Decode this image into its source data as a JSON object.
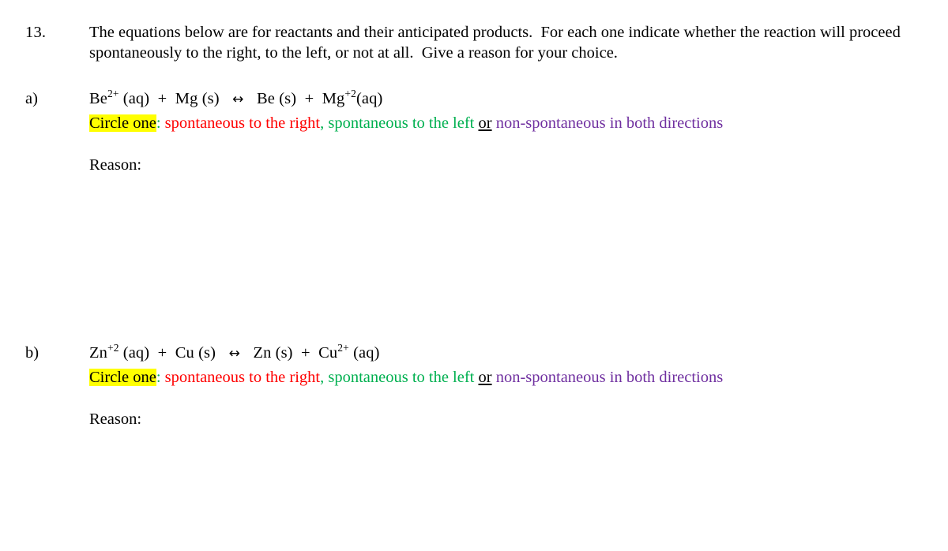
{
  "document": {
    "question_number": "13.",
    "prompt": "The equations below are for reactants and their anticipated products.  For each one indicate whether the reaction will proceed spontaneously to the right, to the left, or not at all.  Give a reason for your choice.",
    "colors": {
      "highlight": "#ffff00",
      "option_right": "#ff0000",
      "option_left": "#00b050",
      "option_none": "#7030a0",
      "text": "#000000"
    },
    "choice_line": {
      "prefix": "Circle one",
      "colon": ":",
      "option_right": "spontaneous to the right",
      "separator_comma": ",",
      "option_left": "spontaneous to the left",
      "or": "or",
      "option_none": "non-spontaneous in both directions"
    },
    "reason_label": "Reason:",
    "parts": [
      {
        "label": "a)",
        "equation": {
          "reactant1_symbol": "Be",
          "reactant1_charge": "2+",
          "reactant1_state": " (aq)",
          "plus1": "  +  ",
          "reactant2_symbol": "Mg",
          "reactant2_charge": "",
          "reactant2_state": " (s)",
          "arrow": "↔",
          "product1_symbol": "Be",
          "product1_charge": "",
          "product1_state": " (s)",
          "plus2": "  +  ",
          "product2_symbol": "Mg",
          "product2_charge": "+2",
          "product2_state": "(aq)"
        }
      },
      {
        "label": "b)",
        "equation": {
          "reactant1_symbol": "Zn",
          "reactant1_charge": "+2",
          "reactant1_state": " (aq)",
          "plus1": "  +  ",
          "reactant2_symbol": "Cu",
          "reactant2_charge": "",
          "reactant2_state": " (s)",
          "arrow": "↔",
          "product1_symbol": "Zn",
          "product1_charge": "",
          "product1_state": " (s)",
          "plus2": "  +  ",
          "product2_symbol": "Cu",
          "product2_charge": "2+",
          "product2_state": " (aq)"
        }
      }
    ]
  }
}
